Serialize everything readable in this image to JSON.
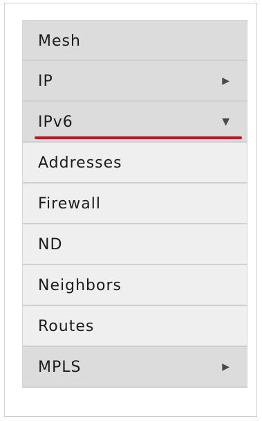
{
  "menu": {
    "items": [
      {
        "label": "Mesh"
      },
      {
        "label": "IP",
        "arrow": "▶"
      },
      {
        "label": "IPv6",
        "arrow": "▼"
      },
      {
        "label": "Addresses"
      },
      {
        "label": "Firewall"
      },
      {
        "label": "ND"
      },
      {
        "label": "Neighbors"
      },
      {
        "label": "Routes"
      },
      {
        "label": "MPLS",
        "arrow": "▶"
      }
    ]
  },
  "colors": {
    "highlight_underline": "#c8101e",
    "parent_bg": "#dcdcdc",
    "child_bg": "#efefef"
  },
  "icons": {
    "collapsed": "triangle-right-icon",
    "expanded": "triangle-down-icon"
  }
}
